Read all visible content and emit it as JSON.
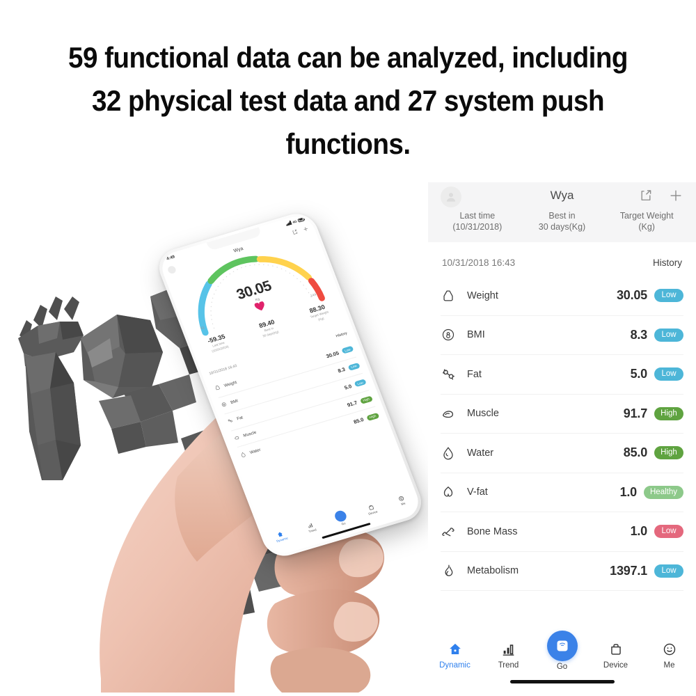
{
  "headline": {
    "lines": [
      "59 functional data can be analyzed, including",
      "32 physical test data and 27 system push",
      "functions."
    ]
  },
  "colors": {
    "badge_low_blue": "#4db6d8",
    "badge_high_green": "#5fa340",
    "badge_healthy_green": "#8dc98a",
    "badge_low_red": "#e4687d",
    "accent_blue": "#2f80ed",
    "go_button_blue": "#3b82e8",
    "header_bg": "#f5f5f6"
  },
  "app": {
    "title": "Wya",
    "avatar_icon": "user-avatar-icon",
    "share_icon": "share-icon",
    "add_icon": "plus-icon",
    "summary_columns": [
      {
        "label_line1": "Last time",
        "label_line2": "(10/31/2018)"
      },
      {
        "label_line1": "Best in",
        "label_line2": "30 days(Kg)"
      },
      {
        "label_line1": "Target Weight",
        "label_line2": "(Kg)"
      }
    ],
    "record_date": "10/31/2018 16:43",
    "history_label": "History",
    "metrics": [
      {
        "icon": "weight-tag-icon",
        "name": "Weight",
        "value": "30.05",
        "badge": "Low",
        "badge_color": "#4db6d8"
      },
      {
        "icon": "bmi-circle-icon",
        "name": "BMI",
        "value": "8.3",
        "badge": "Low",
        "badge_color": "#4db6d8"
      },
      {
        "icon": "fat-cells-icon",
        "name": "Fat",
        "value": "5.0",
        "badge": "Low",
        "badge_color": "#4db6d8"
      },
      {
        "icon": "muscle-bicep-icon",
        "name": "Muscle",
        "value": "91.7",
        "badge": "High",
        "badge_color": "#5fa340"
      },
      {
        "icon": "water-drop-icon",
        "name": "Water",
        "value": "85.0",
        "badge": "High",
        "badge_color": "#5fa340"
      },
      {
        "icon": "visceral-fat-icon",
        "name": "V-fat",
        "value": "1.0",
        "badge": "Healthy",
        "badge_color": "#8dc98a"
      },
      {
        "icon": "bone-icon",
        "name": "Bone Mass",
        "value": "1.0",
        "badge": "Low",
        "badge_color": "#e4687d"
      },
      {
        "icon": "flame-metabolism-icon",
        "name": "Metabolism",
        "value": "1397.1",
        "badge": "Low",
        "badge_color": "#4db6d8"
      }
    ],
    "nav": [
      {
        "icon": "home-icon",
        "label": "Dynamic",
        "active": true
      },
      {
        "icon": "bar-chart-icon",
        "label": "Trend",
        "active": false
      },
      {
        "icon": "scale-icon",
        "label": "Go",
        "active": false
      },
      {
        "icon": "device-bag-icon",
        "label": "Device",
        "active": false
      },
      {
        "icon": "smiley-face-icon",
        "label": "Me",
        "active": false
      }
    ]
  },
  "phone": {
    "status_time": "4:49",
    "network_label": "4G",
    "title": "Wya",
    "gauge_value": "30.05",
    "gauge_unit": "Kg",
    "gauge_min": "51",
    "gauge_max": "144",
    "stats": [
      {
        "value": "-59.35",
        "label_line1": "Last time",
        "label_line2": "(10/31/2018)"
      },
      {
        "value": "89.40",
        "label_line1": "Best in",
        "label_line2": "30 days(Kg)"
      },
      {
        "value": "88.30",
        "label_line1": "Target Weight",
        "label_line2": "(Kg)"
      }
    ],
    "record_date": "10/31/2018 16:43",
    "history_label": "History",
    "metrics": [
      {
        "name": "Weight",
        "value": "30.05",
        "badge": "Low",
        "badge_color": "#4db6d8"
      },
      {
        "name": "BMI",
        "value": "8.3",
        "badge": "Low",
        "badge_color": "#4db6d8"
      },
      {
        "name": "Fat",
        "value": "5.0",
        "badge": "Low",
        "badge_color": "#4db6d8"
      },
      {
        "name": "Muscle",
        "value": "91.7",
        "badge": "High",
        "badge_color": "#5fa340"
      },
      {
        "name": "Water",
        "value": "85.0",
        "badge": "High",
        "badge_color": "#5fa340"
      }
    ],
    "nav": [
      {
        "label": "Dynamic",
        "active": true
      },
      {
        "label": "Trend",
        "active": false
      },
      {
        "label": "Go",
        "active": false
      },
      {
        "label": "Device",
        "active": false
      },
      {
        "label": "Me",
        "active": false
      }
    ]
  }
}
